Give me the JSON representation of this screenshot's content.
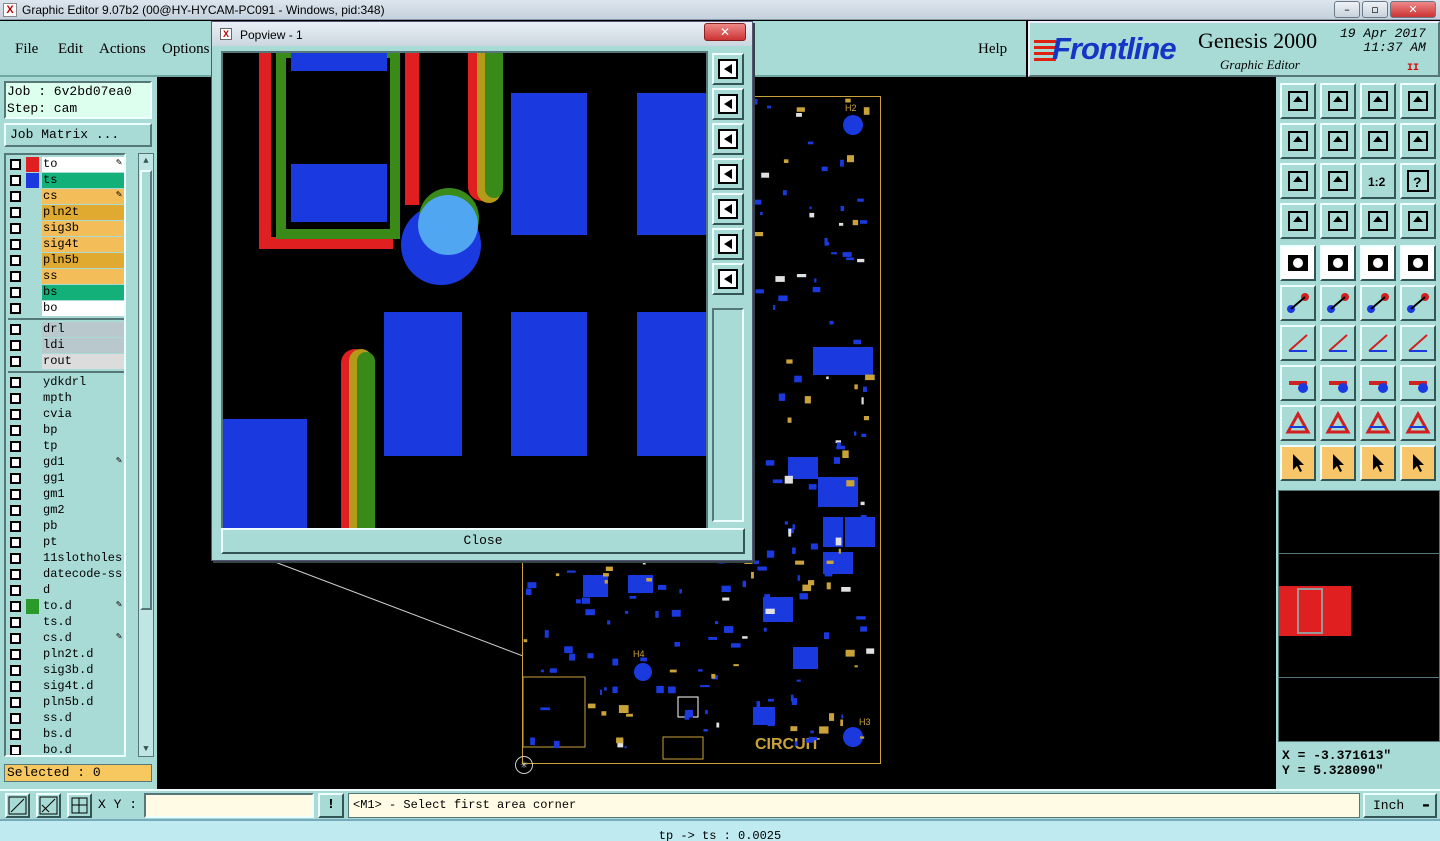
{
  "window": {
    "title": "Graphic Editor 9.07b2 (00@HY-HYCAM-PC091 - Windows, pid:348)",
    "minimize": "–",
    "maximize": "▫",
    "close": "✕"
  },
  "menu": {
    "items": [
      "File",
      "Edit",
      "Actions",
      "Options"
    ],
    "help": "Help"
  },
  "logo": {
    "brand": "Frontline",
    "product": "Genesis 2000",
    "subtitle": "Graphic Editor",
    "date": "19 Apr 2017",
    "time": "11:37 AM",
    "pause": "II"
  },
  "job": {
    "job_line": "Job : 6v2bd07ea0",
    "step_line": "Step: cam",
    "matrix_button": "Job Matrix ..."
  },
  "layers": [
    {
      "name": "to",
      "color": "#ffffff",
      "swatch": "#e02020",
      "edit": true,
      "group": 1
    },
    {
      "name": "ts",
      "color": "#13b07a",
      "swatch": "#1a3ae0",
      "edit": false,
      "group": 1
    },
    {
      "name": "cs",
      "color": "#f3bd5a",
      "swatch": "",
      "edit": true,
      "group": 1
    },
    {
      "name": "pln2t",
      "color": "#e0aa30",
      "swatch": "",
      "edit": false,
      "group": 1
    },
    {
      "name": "sig3b",
      "color": "#f3bd5a",
      "swatch": "",
      "edit": false,
      "group": 1
    },
    {
      "name": "sig4t",
      "color": "#f3bd5a",
      "swatch": "",
      "edit": false,
      "group": 1
    },
    {
      "name": "pln5b",
      "color": "#e0aa30",
      "swatch": "",
      "edit": false,
      "group": 1
    },
    {
      "name": "ss",
      "color": "#f3bd5a",
      "swatch": "",
      "edit": false,
      "group": 1
    },
    {
      "name": "bs",
      "color": "#13b07a",
      "swatch": "",
      "edit": false,
      "group": 1
    },
    {
      "name": "bo",
      "color": "#ffffff",
      "swatch": "",
      "edit": false,
      "group": 1
    },
    {
      "name": "drl",
      "color": "#b9c8cc",
      "swatch": "",
      "edit": false,
      "group": 2
    },
    {
      "name": "ldi",
      "color": "#b9c8cc",
      "swatch": "",
      "edit": false,
      "group": 2
    },
    {
      "name": "rout",
      "color": "#dcdcdc",
      "swatch": "",
      "edit": false,
      "group": 2
    },
    {
      "name": "ydkdrl",
      "color": "#a9dbd6",
      "swatch": "",
      "edit": false,
      "group": 3
    },
    {
      "name": "mpth",
      "color": "#a9dbd6",
      "swatch": "",
      "edit": false,
      "group": 3
    },
    {
      "name": "cvia",
      "color": "#a9dbd6",
      "swatch": "",
      "edit": false,
      "group": 3
    },
    {
      "name": "bp",
      "color": "#a9dbd6",
      "swatch": "",
      "edit": false,
      "group": 3
    },
    {
      "name": "tp",
      "color": "#a9dbd6",
      "swatch": "",
      "edit": false,
      "group": 3
    },
    {
      "name": "gd1",
      "color": "#a9dbd6",
      "swatch": "",
      "edit": true,
      "group": 3
    },
    {
      "name": "gg1",
      "color": "#a9dbd6",
      "swatch": "",
      "edit": false,
      "group": 3
    },
    {
      "name": "gm1",
      "color": "#a9dbd6",
      "swatch": "",
      "edit": false,
      "group": 3
    },
    {
      "name": "gm2",
      "color": "#a9dbd6",
      "swatch": "",
      "edit": false,
      "group": 3
    },
    {
      "name": "pb",
      "color": "#a9dbd6",
      "swatch": "",
      "edit": false,
      "group": 3
    },
    {
      "name": "pt",
      "color": "#a9dbd6",
      "swatch": "",
      "edit": false,
      "group": 3
    },
    {
      "name": "11slotholes",
      "color": "#a9dbd6",
      "swatch": "",
      "edit": false,
      "group": 3
    },
    {
      "name": "datecode-ss",
      "color": "#a9dbd6",
      "swatch": "",
      "edit": false,
      "group": 3
    },
    {
      "name": "d",
      "color": "#a9dbd6",
      "swatch": "",
      "edit": false,
      "group": 3
    },
    {
      "name": "to.d",
      "color": "#a9dbd6",
      "swatch": "#2a9a2a",
      "edit": true,
      "group": 3
    },
    {
      "name": "ts.d",
      "color": "#a9dbd6",
      "swatch": "",
      "edit": false,
      "group": 3
    },
    {
      "name": "cs.d",
      "color": "#a9dbd6",
      "swatch": "",
      "edit": true,
      "group": 3
    },
    {
      "name": "pln2t.d",
      "color": "#a9dbd6",
      "swatch": "",
      "edit": false,
      "group": 3
    },
    {
      "name": "sig3b.d",
      "color": "#a9dbd6",
      "swatch": "",
      "edit": false,
      "group": 3
    },
    {
      "name": "sig4t.d",
      "color": "#a9dbd6",
      "swatch": "",
      "edit": false,
      "group": 3
    },
    {
      "name": "pln5b.d",
      "color": "#a9dbd6",
      "swatch": "",
      "edit": false,
      "group": 3
    },
    {
      "name": "ss.d",
      "color": "#a9dbd6",
      "swatch": "",
      "edit": false,
      "group": 3
    },
    {
      "name": "bs.d",
      "color": "#a9dbd6",
      "swatch": "",
      "edit": false,
      "group": 3
    },
    {
      "name": "bo.d",
      "color": "#a9dbd6",
      "swatch": "",
      "edit": false,
      "group": 3
    }
  ],
  "selected": "Selected : 0",
  "popview": {
    "title": "Popview - 1",
    "close_label": "Close",
    "close_x": "✕"
  },
  "board": {
    "labels": [
      "H2",
      "H4",
      "H3"
    ],
    "logo_text": "CIRCUIT"
  },
  "coords": {
    "x": "X = -3.371613\"",
    "y": "Y = 5.328090\""
  },
  "bottom": {
    "xy_label": "X Y :",
    "xy_value": "",
    "warn": "!",
    "prompt": "<M1> - Select first area corner",
    "unit": "Inch",
    "unit_arrow": "▬"
  },
  "status": "tp -> ts : 0.0025",
  "toolbar": {
    "ratio": "1:2",
    "help": "?"
  }
}
